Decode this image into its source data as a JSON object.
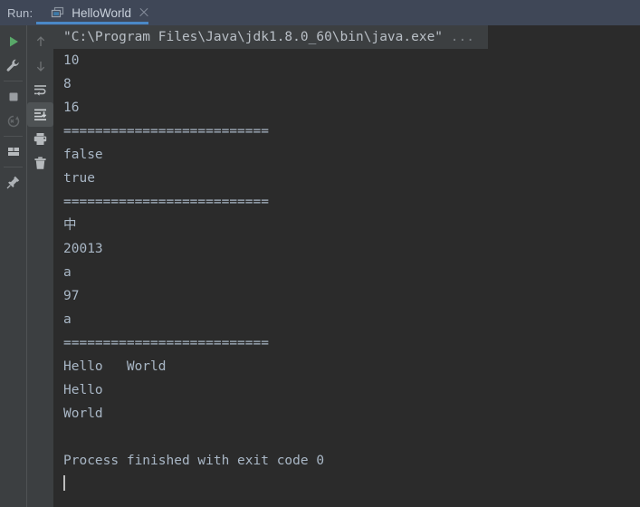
{
  "window": {
    "title": "Run",
    "background_color": "#2b2b2b",
    "header_color": "#3f4757",
    "sidebar_color": "#3c3f41",
    "accent_color": "#4a88c7",
    "console_text_color": "#a9b7c6"
  },
  "header": {
    "run_label": "Run:",
    "tab": {
      "label": "HelloWorld",
      "icon": "run-configuration-icon",
      "close_icon": "close-icon",
      "active": true
    }
  },
  "toolbar_left": [
    {
      "name": "rerun-button",
      "icon": "play-icon",
      "label": "Rerun",
      "enabled": true
    },
    {
      "name": "edit-configuration-button",
      "icon": "wrench-icon",
      "label": "Edit Configuration",
      "enabled": true
    },
    {
      "separator": true
    },
    {
      "name": "stop-button",
      "icon": "stop-square-icon",
      "label": "Stop",
      "enabled": true
    },
    {
      "name": "rerun-failed-button",
      "icon": "rerun-failed-icon",
      "label": "Rerun Failed",
      "enabled": false
    },
    {
      "separator": true
    },
    {
      "name": "layout-button",
      "icon": "layout-icon",
      "label": "Layout Settings",
      "enabled": true
    },
    {
      "separator": true
    },
    {
      "name": "pin-tab-button",
      "icon": "pin-icon",
      "label": "Pin Tab",
      "enabled": true
    }
  ],
  "toolbar_right": [
    {
      "name": "up-the-stack-trace-button",
      "icon": "arrow-up-icon",
      "label": "Up the Stack Trace",
      "enabled": false
    },
    {
      "name": "down-the-stack-trace-button",
      "icon": "arrow-down-icon",
      "label": "Down the Stack Trace",
      "enabled": false
    },
    {
      "name": "soft-wrap-button",
      "icon": "soft-wrap-icon",
      "label": "Use Soft Wraps",
      "enabled": true
    },
    {
      "name": "scroll-to-end-button",
      "icon": "scroll-to-end-icon",
      "label": "Scroll to the End",
      "enabled": true,
      "selected": true
    },
    {
      "name": "print-button",
      "icon": "printer-icon",
      "label": "Print",
      "enabled": true
    },
    {
      "name": "clear-all-button",
      "icon": "trash-icon",
      "label": "Clear All",
      "enabled": true
    }
  ],
  "console": {
    "command_line": {
      "text": "\"C:\\Program Files\\Java\\jdk1.8.0_60\\bin\\java.exe\" ",
      "ellipsis": "..."
    },
    "lines": [
      "10",
      "8",
      "16",
      "==========================",
      "false",
      "true",
      "==========================",
      "中",
      "20013",
      "a",
      "97",
      "a",
      "==========================",
      "Hello   World",
      "Hello",
      "World",
      "",
      "Process finished with exit code 0"
    ],
    "caret_visible": true
  }
}
